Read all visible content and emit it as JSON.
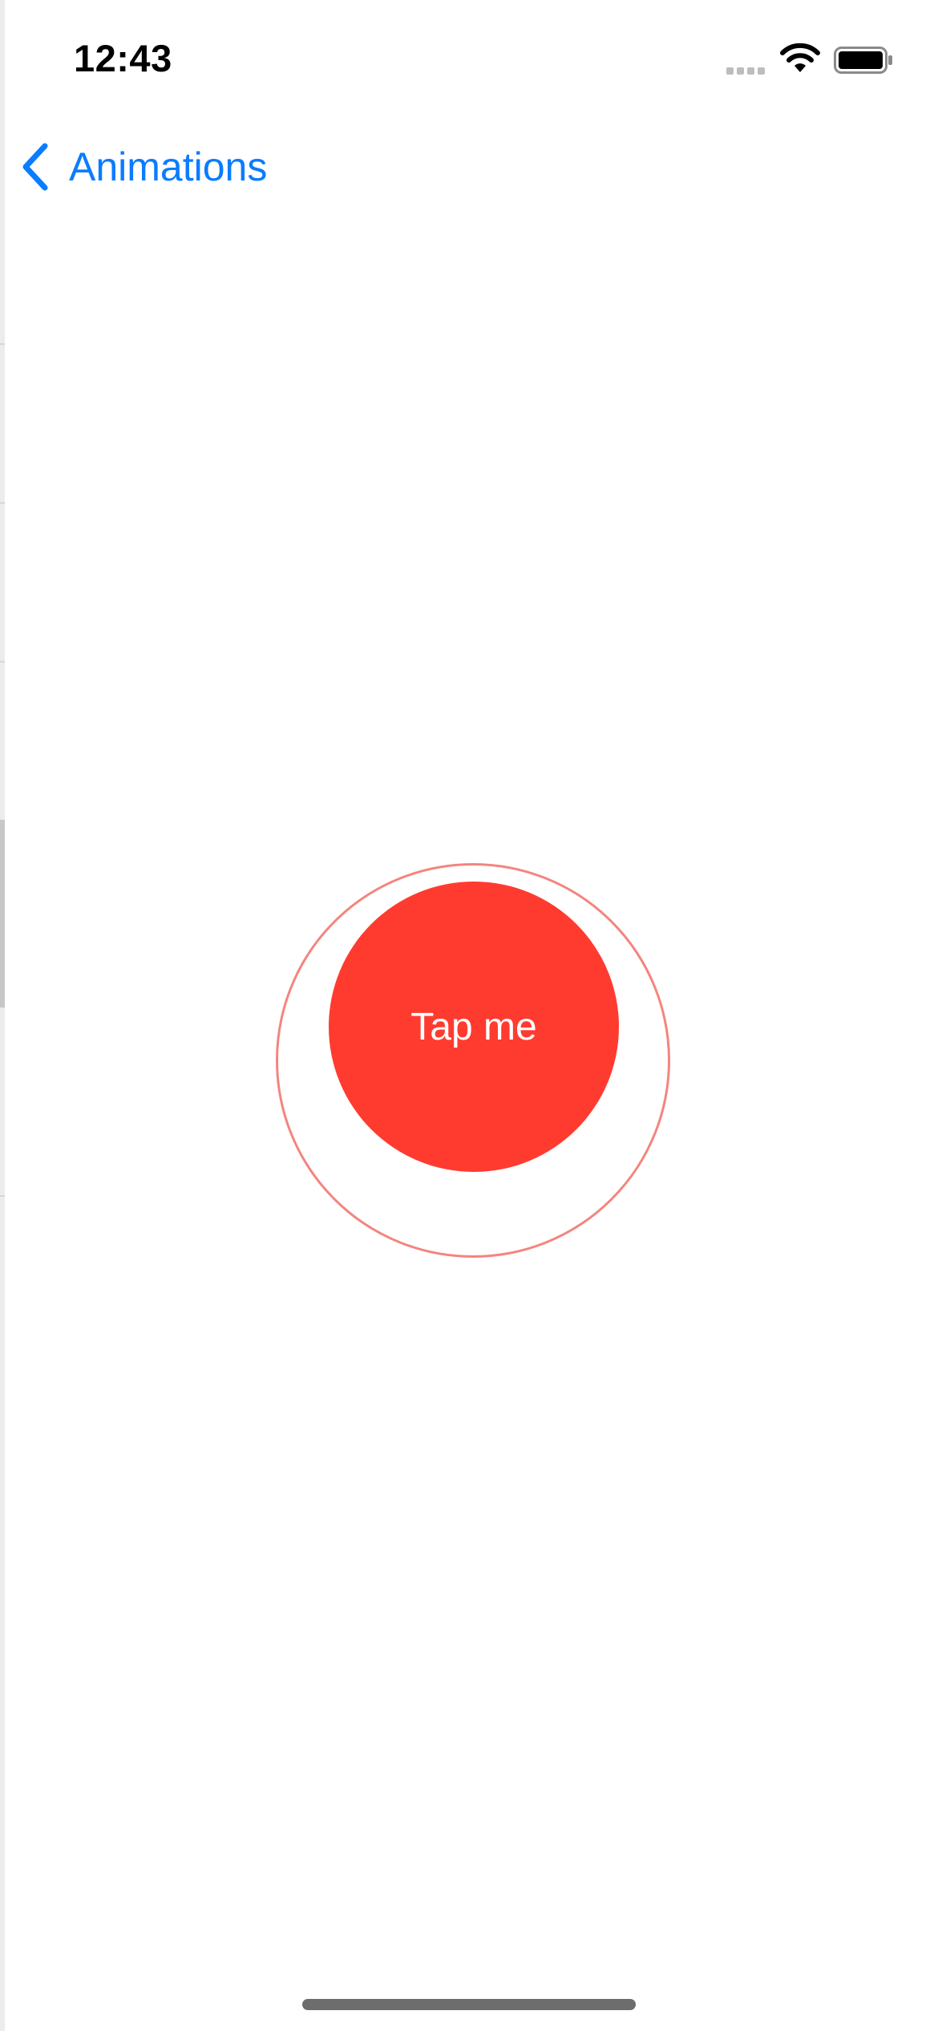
{
  "status_bar": {
    "time": "12:43",
    "signal_icon": "signal-bars-icon",
    "wifi_icon": "wifi-icon",
    "battery_icon": "battery-icon"
  },
  "nav": {
    "back_icon": "chevron-left-icon",
    "back_label": "Animations",
    "accent_color": "#0a7cff"
  },
  "main": {
    "button_label": "Tap me",
    "button_color": "#ff3b30",
    "ring_color": "#f3857e"
  }
}
